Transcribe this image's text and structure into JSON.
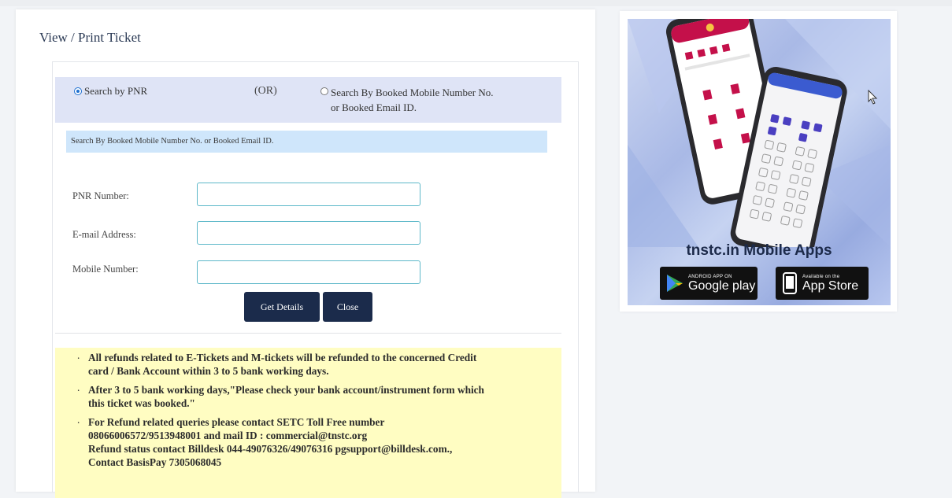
{
  "page": {
    "title": "View / Print Ticket"
  },
  "search_mode": {
    "pnr_label": "Search by PNR",
    "or_label": "(OR)",
    "mobile_label_line1": "Search By Booked Mobile Number No.",
    "mobile_label_line2": "or Booked Email ID.",
    "selected": "pnr"
  },
  "info_bar": {
    "text": "Search By Booked Mobile Number No. or Booked Email ID."
  },
  "form": {
    "pnr_label": "PNR Number:",
    "pnr_value": "",
    "email_label": "E-mail Address:",
    "email_value": "",
    "mobile_label": "Mobile Number:",
    "mobile_value": ""
  },
  "buttons": {
    "get_details": "Get Details",
    "close": "Close"
  },
  "notice": {
    "items": [
      {
        "line1": "All refunds related to E-Tickets and M-tickets will be refunded to the concerned Credit",
        "line2": "card / Bank Account within 3 to 5 bank working days."
      },
      {
        "line1": "After 3 to 5 bank working days,\"Please check your bank account/instrument form which",
        "line2": "this ticket was booked.\""
      },
      {
        "line1": "For Refund related queries please contact SETC Toll Free number",
        "line2": "08066006572/9513948001 and mail ID : commercial@tnstc.org",
        "line3": "Refund status contact Billdesk 044-49076326/49076316 pgsupport@billdesk.com.,",
        "line4": "Contact BasisPay 7305068045"
      }
    ]
  },
  "app_banner": {
    "title": "tnstc.in Mobile Apps",
    "google_play_small": "ANDROID APP ON",
    "google_play_big": "Google play",
    "app_store_small": "Available on the",
    "app_store_big": "App Store"
  },
  "colors": {
    "button_bg": "#1b2b4b",
    "mode_row_bg": "#dfe4f6",
    "info_bar_bg": "#cfe6fb",
    "notice_bg": "#fffdc2",
    "input_border": "#5db8c9"
  }
}
